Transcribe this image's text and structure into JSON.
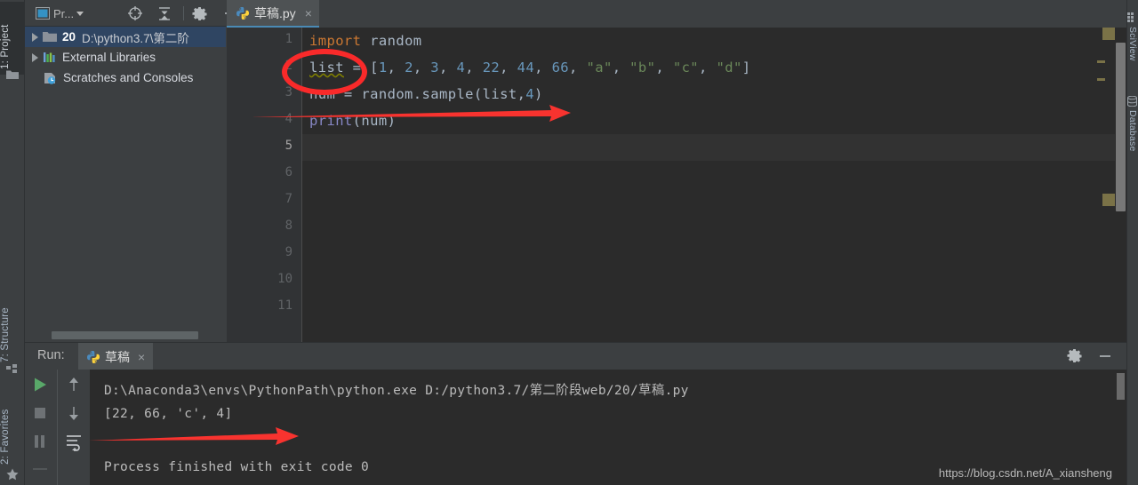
{
  "window": {
    "theme_accent": "#4a8ab5",
    "bg": "#3c3f41",
    "editor_bg": "#2b2b2b"
  },
  "left_tool_strip": {
    "tabs": [
      {
        "label": "1: Project",
        "selected": true,
        "icon": "folder-icon"
      },
      {
        "label": "7: Structure",
        "selected": false,
        "icon": "structure-icon"
      },
      {
        "label": "2: Favorites",
        "selected": false,
        "icon": "star-icon"
      }
    ]
  },
  "right_tool_strip": {
    "tabs": [
      {
        "label": "SciView",
        "icon": "grid-icon"
      },
      {
        "label": "Database",
        "icon": "database-icon"
      }
    ]
  },
  "project_panel": {
    "toolbar": {
      "view_selector_label": "Pr...",
      "view_selector_icon": "project-view-icon",
      "locate_icon": "crosshair-icon",
      "collapse_all_icon": "collapse-all-icon",
      "settings_icon": "gear-icon",
      "hide_icon": "minimize-icon"
    },
    "tree": [
      {
        "name": "20",
        "path": "D:\\python3.7\\第二阶",
        "icon": "folder-icon",
        "expandable": true,
        "selected": true,
        "indent": 0
      },
      {
        "name": "External Libraries",
        "path": "",
        "icon": "library-icon",
        "expandable": true,
        "selected": false,
        "indent": 0
      },
      {
        "name": "Scratches and Consoles",
        "path": "",
        "icon": "scratches-icon",
        "expandable": false,
        "selected": false,
        "indent": 0
      }
    ]
  },
  "editor": {
    "tab": {
      "title": "草稿.py",
      "icon": "python-file-icon",
      "close_label": "×"
    },
    "current_line": 5,
    "line_numbers": [
      "1",
      "2",
      "3",
      "4",
      "5",
      "6",
      "7",
      "8",
      "9",
      "10",
      "11"
    ],
    "code_lines": [
      {
        "n": 1,
        "tokens": [
          {
            "t": "import",
            "c": "kw"
          },
          {
            "t": " random",
            "c": "def"
          }
        ]
      },
      {
        "n": 2,
        "tokens": [
          {
            "t": "list",
            "c": "def err"
          },
          {
            "t": " = ",
            "c": "def"
          },
          {
            "t": "[",
            "c": "def"
          },
          {
            "t": "1",
            "c": "num"
          },
          {
            "t": ", ",
            "c": "def"
          },
          {
            "t": "2",
            "c": "num"
          },
          {
            "t": ", ",
            "c": "def"
          },
          {
            "t": "3",
            "c": "num"
          },
          {
            "t": ", ",
            "c": "def"
          },
          {
            "t": "4",
            "c": "num"
          },
          {
            "t": ", ",
            "c": "def"
          },
          {
            "t": "22",
            "c": "num"
          },
          {
            "t": ", ",
            "c": "def"
          },
          {
            "t": "44",
            "c": "num"
          },
          {
            "t": ", ",
            "c": "def"
          },
          {
            "t": "66",
            "c": "num"
          },
          {
            "t": ", ",
            "c": "def"
          },
          {
            "t": "\"a\"",
            "c": "str"
          },
          {
            "t": ", ",
            "c": "def"
          },
          {
            "t": "\"b\"",
            "c": "str"
          },
          {
            "t": ", ",
            "c": "def"
          },
          {
            "t": "\"c\"",
            "c": "str"
          },
          {
            "t": ", ",
            "c": "def"
          },
          {
            "t": "\"d\"",
            "c": "str"
          },
          {
            "t": "]",
            "c": "def"
          }
        ]
      },
      {
        "n": 3,
        "tokens": [
          {
            "t": "num = random.sample(list,",
            "c": "def"
          },
          {
            "t": "4",
            "c": "num"
          },
          {
            "t": ")",
            "c": "def"
          }
        ]
      },
      {
        "n": 4,
        "tokens": [
          {
            "t": "print",
            "c": "bif"
          },
          {
            "t": "(num)",
            "c": "def"
          }
        ]
      }
    ],
    "plain_text": [
      "import random",
      "list = [1, 2, 3, 4, 22, 44, 66, \"a\", \"b\", \"c\", \"d\"]",
      "num = random.sample(list,4)",
      "print(num)"
    ]
  },
  "run_panel": {
    "title": "Run:",
    "tab": {
      "title": "草稿",
      "icon": "python-run-icon",
      "close_label": "×"
    },
    "header_actions": {
      "settings_icon": "gear-icon",
      "hide_icon": "minimize-icon"
    },
    "side_buttons": [
      {
        "name": "rerun-button",
        "icon": "play-icon",
        "color": "#59a869"
      },
      {
        "name": "stop-button",
        "icon": "stop-icon",
        "color": "#6e7275"
      },
      {
        "name": "pause-button",
        "icon": "pause-icon",
        "color": "#6e7275"
      },
      {
        "name": "up-stacktrace-button",
        "icon": "arrow-up-icon",
        "color": "#9a9fa3"
      },
      {
        "name": "down-stacktrace-button",
        "icon": "arrow-down-icon",
        "color": "#9a9fa3"
      },
      {
        "name": "soft-wrap-button",
        "icon": "soft-wrap-icon",
        "color": "#c0c3c6"
      }
    ],
    "console_lines": [
      "D:\\Anaconda3\\envs\\PythonPath\\python.exe D:/python3.7/第二阶段web/20/草稿.py",
      "[22, 66, 'c', 4]",
      "",
      "Process finished with exit code 0"
    ],
    "watermark": "https://blog.csdn.net/A_xiansheng"
  },
  "annotations": {
    "ellipse": {
      "target": "list-variable-on-line-2",
      "color": "#f92a2a"
    },
    "arrow_editor": {
      "target": "sample-call-line-3",
      "color": "#f92a2a"
    },
    "arrow_console": {
      "target": "output-line",
      "color": "#f92a2a"
    }
  }
}
